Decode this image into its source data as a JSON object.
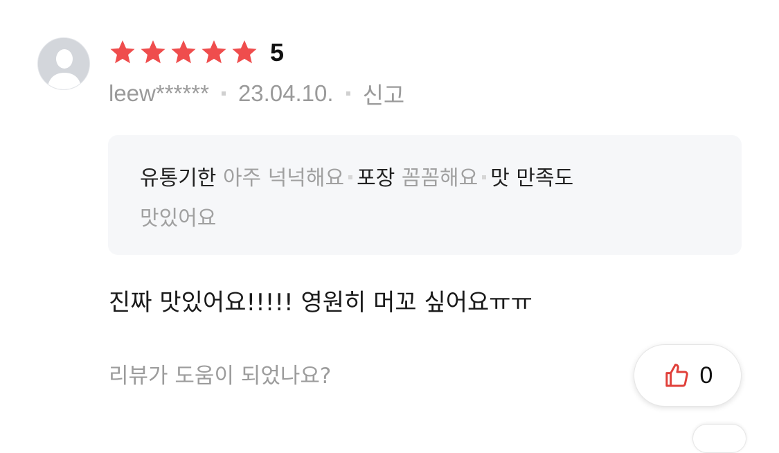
{
  "review": {
    "rating": {
      "stars_filled": 5,
      "stars_total": 5,
      "value": "5",
      "star_color": "#ef4d4d"
    },
    "author": {
      "username": "leew******",
      "avatar_icon": "default-user-avatar-icon"
    },
    "date": "23.04.10.",
    "report_label": "신고",
    "tags": [
      {
        "key": "유통기한",
        "value": "아주 넉넉해요"
      },
      {
        "key": "포장",
        "value": "꼼꼼해요"
      },
      {
        "key": "맛 만족도",
        "value": "맛있어요"
      }
    ],
    "body": "진짜 맛있어요!!!!! 영원히 머꼬 싶어요ㅠㅠ",
    "helpful": {
      "question": "리뷰가 도움이 되었나요?",
      "like_icon": "thumbs-up-icon",
      "like_count": "0",
      "like_icon_color": "#e0403a"
    }
  }
}
